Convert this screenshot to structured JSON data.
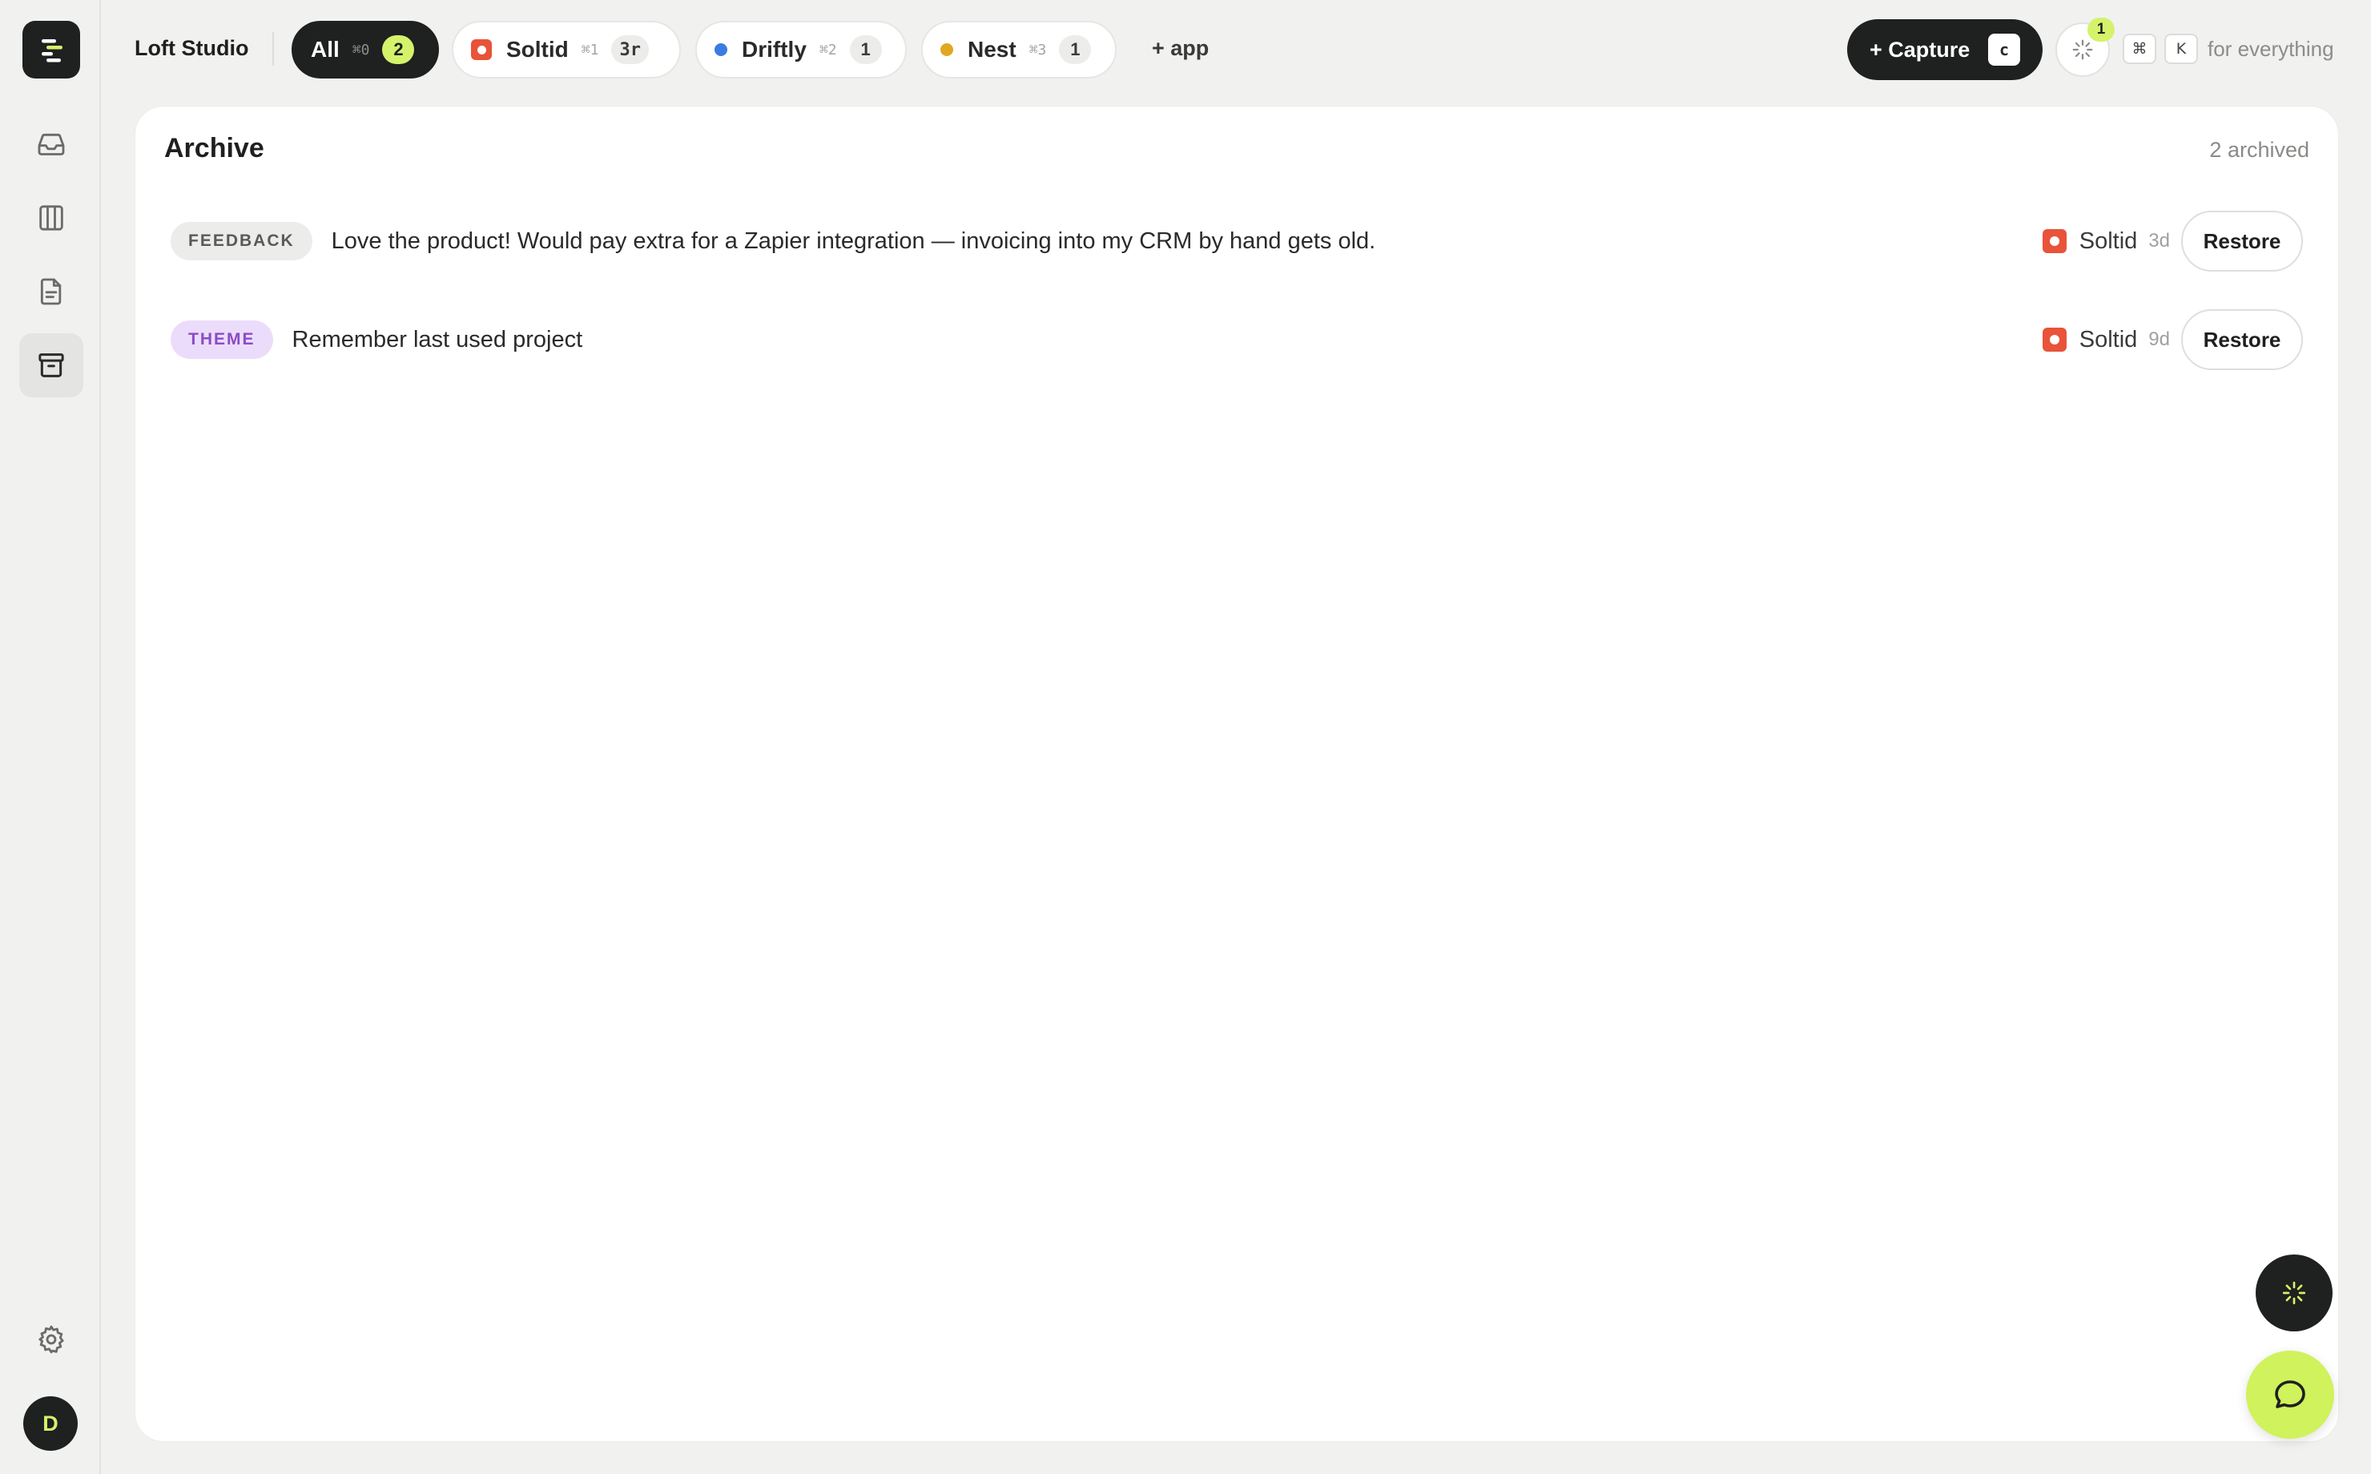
{
  "workspace": {
    "name": "Loft Studio"
  },
  "user": {
    "avatar_initial": "D"
  },
  "sidebar": {
    "items": [
      {
        "name": "inbox",
        "icon": "inbox-icon"
      },
      {
        "name": "board",
        "icon": "columns-icon"
      },
      {
        "name": "docs",
        "icon": "document-icon"
      },
      {
        "name": "archive",
        "icon": "archive-icon",
        "active": true
      }
    ],
    "settings_icon": "gear-icon"
  },
  "app_filters": [
    {
      "label": "All",
      "shortcut": "⌘0",
      "count": "2",
      "active": true
    },
    {
      "label": "Soltid",
      "shortcut": "⌘1",
      "count": "3r",
      "color": "#e8533a"
    },
    {
      "label": "Driftly",
      "shortcut": "⌘2",
      "count": "1",
      "color": "#3b7be0"
    },
    {
      "label": "Nest",
      "shortcut": "⌘3",
      "count": "1",
      "color": "#e0a820"
    }
  ],
  "add_app_label": "+ app",
  "toolbar": {
    "capture_label": "+ Capture",
    "capture_key": "c",
    "ai_badge_count": "1",
    "palette_keys": [
      "⌘",
      "K"
    ],
    "palette_hint": "for everything"
  },
  "archive": {
    "title": "Archive",
    "count_label": "2 archived",
    "items": [
      {
        "tag": "FEEDBACK",
        "text": "Love the product! Would pay extra for a Zapier integration — invoicing into my CRM by hand gets old.",
        "app": "Soltid",
        "age": "3d",
        "action": "Restore"
      },
      {
        "tag": "THEME",
        "text": "Remember last used project",
        "app": "Soltid",
        "age": "9d",
        "action": "Restore"
      }
    ]
  },
  "colors": {
    "accent": "#d4f36b",
    "dark": "#1f2020",
    "soltid": "#e8533a",
    "driftly": "#3b7be0",
    "nest": "#e0a820",
    "theme_tag": "#8a4cc6"
  }
}
